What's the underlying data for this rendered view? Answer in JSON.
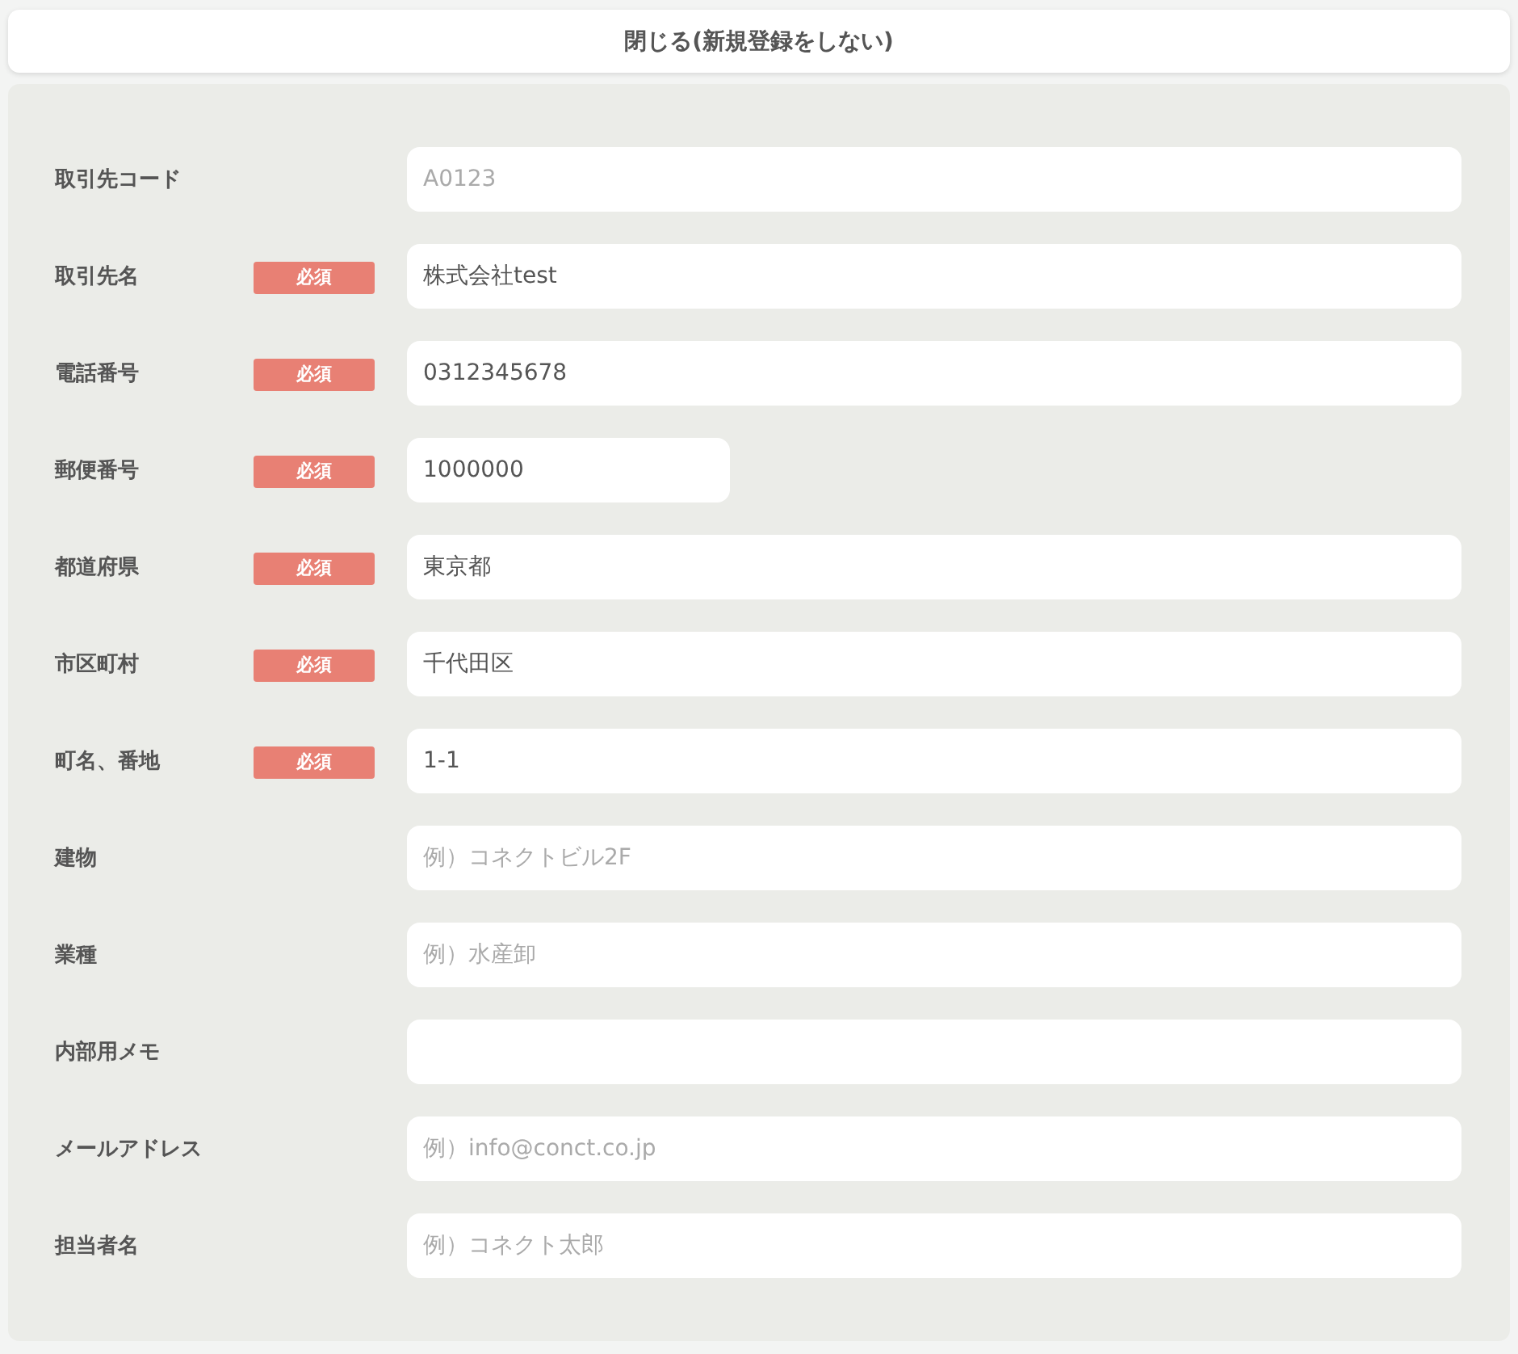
{
  "close_button": {
    "label": "閉じる(新規登録をしない)"
  },
  "fields": [
    {
      "label": "取引先コード",
      "placeholder": "A0123",
      "kind": "full"
    },
    {
      "label": "取引先名",
      "badge": "必須",
      "value": "株式会社test",
      "kind": "full"
    },
    {
      "label": "電話番号",
      "badge": "必須",
      "value": "0312345678",
      "kind": "full"
    },
    {
      "label": "郵便番号",
      "badge": "必須",
      "value": "1000000",
      "kind": "short"
    },
    {
      "label": "都道府県",
      "badge": "必須",
      "value": "東京都",
      "kind": "full"
    },
    {
      "label": "市区町村",
      "badge": "必須",
      "value": "千代田区",
      "kind": "full"
    },
    {
      "label": "町名、番地",
      "badge": "必須",
      "value": "1-1",
      "kind": "full"
    },
    {
      "label": "建物",
      "placeholder": "例）コネクトビル2F",
      "kind": "full"
    },
    {
      "label": "業種",
      "placeholder": "例）水産卸",
      "kind": "full"
    },
    {
      "label": "内部用メモ",
      "kind": "full"
    },
    {
      "label": "メールアドレス",
      "placeholder": "例）info@conct.co.jp",
      "kind": "full"
    },
    {
      "label": "担当者名",
      "placeholder": "例）コネクト太郎",
      "kind": "full"
    }
  ]
}
